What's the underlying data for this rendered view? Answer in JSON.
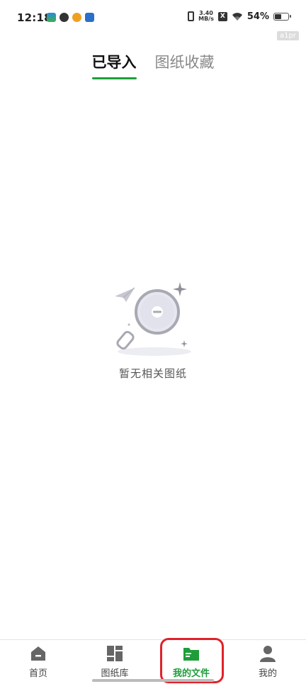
{
  "status_bar": {
    "time": "12:18",
    "net_speed_value": "3.40",
    "net_speed_unit": "MB/s",
    "sim_label": "X",
    "battery_percent": "54%",
    "battery_level": 0.54,
    "app_icons": [
      "app-icon-1",
      "app-icon-2",
      "weibo-icon",
      "app-icon-4"
    ]
  },
  "watermark": "a1pr",
  "tabs": [
    {
      "label": "已导入",
      "active": true
    },
    {
      "label": "图纸收藏",
      "active": false
    }
  ],
  "empty_state": {
    "message": "暂无相关图纸",
    "icon": "magnifier-empty-icon"
  },
  "bottom_nav": {
    "items": [
      {
        "label": "首页",
        "icon": "home-icon",
        "active": false
      },
      {
        "label": "图纸库",
        "icon": "library-grid-icon",
        "active": false
      },
      {
        "label": "我的文件",
        "icon": "folder-icon",
        "active": true
      },
      {
        "label": "我的",
        "icon": "person-icon",
        "active": false
      }
    ]
  },
  "colors": {
    "accent": "#1f9d3a",
    "highlight_box": "#e0222a",
    "icon_gray": "#666666"
  }
}
